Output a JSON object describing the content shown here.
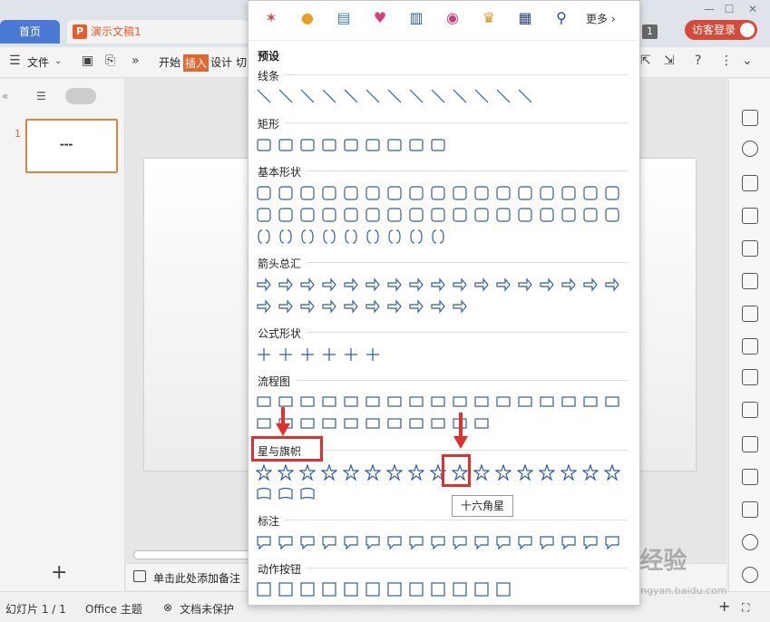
{
  "tabs": {
    "home": "首页",
    "doc": "演示文稿1"
  },
  "titlebar": {
    "badge": "1",
    "login": "访客登录"
  },
  "menu": {
    "file": "文件",
    "start": "开始",
    "insert": "插入",
    "design": "设计",
    "cut": "切"
  },
  "slide_panel": {
    "slide_number": "1"
  },
  "notes_placeholder": "单击此处添加备注",
  "status": {
    "slide_count": "幻灯片 1 / 1",
    "theme": "Office 主题",
    "protect": "文档未保护"
  },
  "shapes_panel": {
    "more_label": "更多",
    "preset_title": "预设",
    "sections": {
      "lines": "线条",
      "rect": "矩形",
      "basic": "基本形状",
      "arrows": "箭头总汇",
      "formula": "公式形状",
      "flowchart": "流程图",
      "stars": "星与旗帜",
      "callouts": "标注",
      "actions": "动作按钮"
    },
    "tooltip": "十六角星"
  },
  "watermark": {
    "text": "Bai 经验",
    "url": "jingyan.baidu.com"
  },
  "colors": {
    "accent": "#e0692f",
    "highlight": "#e03030",
    "home_tab": "#4a7ad6",
    "shape_stroke": "#2f5f9e"
  }
}
